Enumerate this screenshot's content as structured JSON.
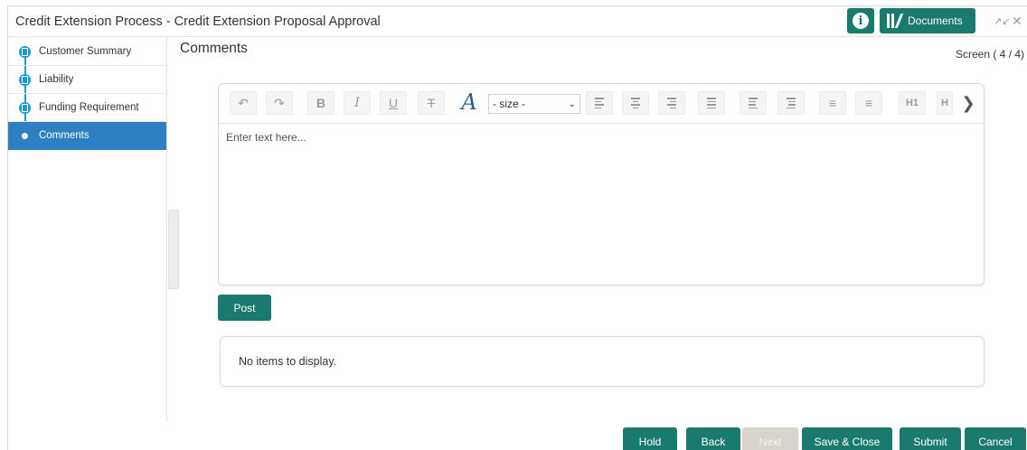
{
  "window": {
    "title": "Credit Extension Process - Credit Extension Proposal Approval",
    "info_icon": "info-icon",
    "documents_label": "Documents",
    "documents_icon": "library-icon",
    "expand_icon": "expand-icon",
    "close_icon": "close-icon"
  },
  "sidebar": {
    "items": [
      {
        "label": "Customer Summary",
        "state": "completed"
      },
      {
        "label": "Liability",
        "state": "completed"
      },
      {
        "label": "Funding Requirement",
        "state": "completed"
      },
      {
        "label": "Comments",
        "state": "active"
      }
    ]
  },
  "main": {
    "section_title": "Comments",
    "screen_count": "Screen ( 4 / 4)"
  },
  "editor": {
    "toolbar": {
      "undo_icon": "undo-icon",
      "redo_icon": "redo-icon",
      "bold": "B",
      "italic": "I",
      "underline": "U",
      "strike": "T",
      "font_color": "A",
      "size_selected": "- size -",
      "heading1": "H1",
      "heading2": "H"
    },
    "placeholder": "Enter text here..."
  },
  "post_label": "Post",
  "items_empty": "No items to display.",
  "footer": {
    "hold": "Hold",
    "back": "Back",
    "next": "Next",
    "save_close": "Save & Close",
    "submit": "Submit",
    "cancel": "Cancel"
  },
  "colors": {
    "primary": "#1a7a6e",
    "step_active": "#2f7fc3",
    "step_dot": "#1a9bd7",
    "disabled": "#d8d4cc"
  }
}
